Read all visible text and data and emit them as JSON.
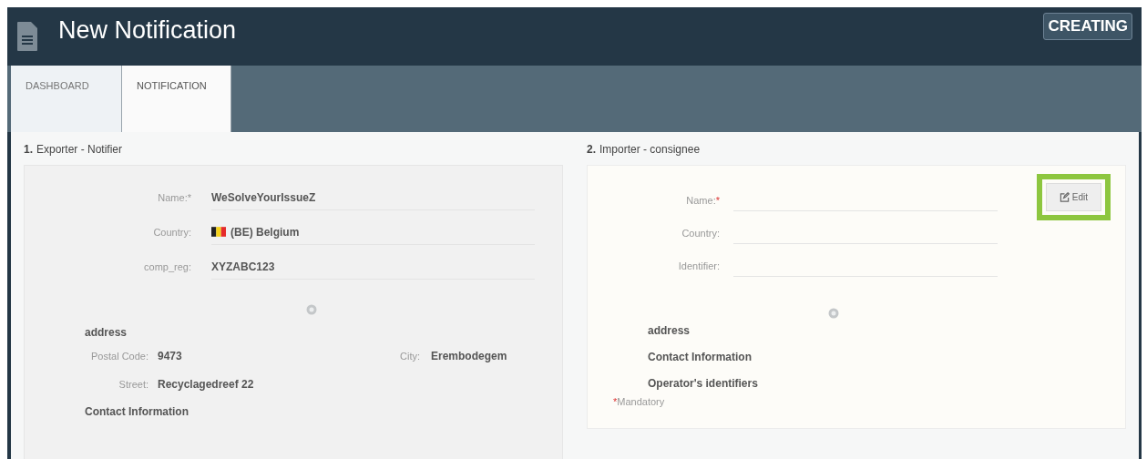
{
  "header": {
    "title": "New Notification",
    "status": "CREATING"
  },
  "tabs": [
    {
      "label": "DASHBOARD",
      "selected": false
    },
    {
      "label": "NOTIFICATION",
      "selected": true
    }
  ],
  "exporter": {
    "number": "1.",
    "title": "Exporter - Notifier",
    "fields": [
      {
        "label": "Name:*",
        "value": "WeSolveYourIssueZ"
      },
      {
        "label": "Country:",
        "value": "(BE) Belgium",
        "kind": "country"
      },
      {
        "label": "comp_reg:",
        "value": "XYZABC123"
      }
    ],
    "address_heading": "address",
    "postal_label": "Postal Code:",
    "postal_value": "9473",
    "city_label": "City:",
    "city_value": "Erembodegem",
    "street_label": "Street:",
    "street_value": "Recyclagedreef 22",
    "sections": [
      "Contact Information"
    ]
  },
  "importer": {
    "number": "2.",
    "title": "Importer - consignee",
    "fields": [
      {
        "label": "Name:",
        "required_mark": "*"
      },
      {
        "label": "Country:"
      },
      {
        "label": "Identifier:"
      }
    ],
    "edit_button": {
      "label": "Edit",
      "highlighted": true
    },
    "sections": [
      "address",
      "Contact Information",
      "Operator's identifiers"
    ],
    "mandatory": {
      "mark": "*",
      "text": "Mandatory"
    }
  }
}
